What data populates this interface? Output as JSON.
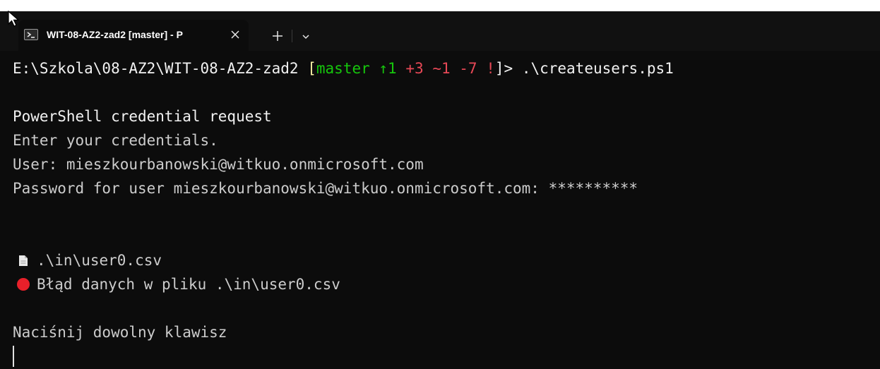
{
  "tab": {
    "title": "WIT-08-AZ2-zad2 [master] - P",
    "icon": "powershell-icon"
  },
  "prompt": {
    "path": "E:\\Szkola\\08-AZ2\\WIT-08-AZ2-zad2",
    "open_bracket": "[",
    "branch": "master",
    "ahead": "↑1",
    "added": "+3",
    "modified": "~1",
    "deleted": "-7",
    "flag": "!",
    "close_bracket": "]>",
    "command": ".\\createusers.ps1"
  },
  "output": {
    "credential_title": "PowerShell credential request",
    "credential_prompt": "Enter your credentials.",
    "user_line": "User: mieszkourbanowski@witkuo.onmicrosoft.com",
    "password_line": "Password for user mieszkourbanowski@witkuo.onmicrosoft.com: **********",
    "file_line": ".\\in\\user0.csv",
    "error_line": "Błąd danych w pliku .\\in\\user0.csv",
    "press_key": "Naciśnij dowolny klawisz"
  },
  "colors": {
    "background": "#0c0c0c",
    "text": "#cccccc",
    "branch": "#16c60c",
    "error": "#e74856",
    "bracket": "#f9f1a5"
  }
}
